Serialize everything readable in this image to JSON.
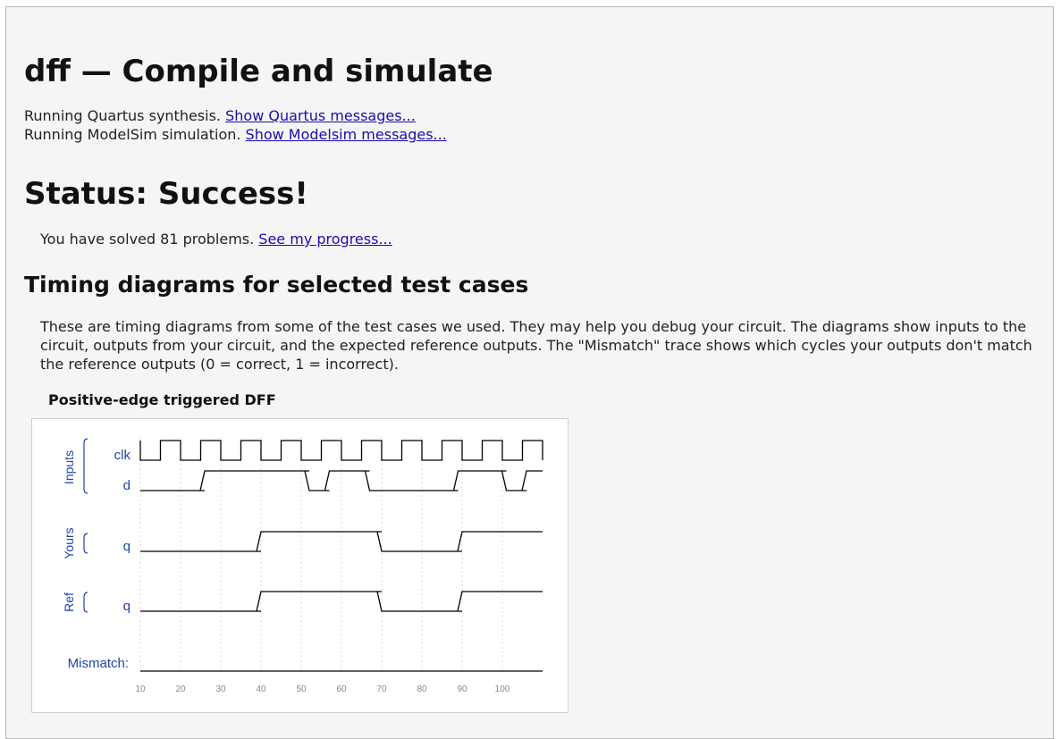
{
  "header": {
    "title": "dff — Compile and simulate"
  },
  "compile": {
    "quartus_text": "Running Quartus synthesis.",
    "quartus_link": "Show Quartus messages...",
    "modelsim_text": "Running ModelSim simulation.",
    "modelsim_link": "Show Modelsim messages..."
  },
  "status": {
    "heading": "Status: Success!",
    "solved_text": "You have solved 81 problems.",
    "progress_link": "See my progress..."
  },
  "timing": {
    "heading": "Timing diagrams for selected test cases",
    "description": "These are timing diagrams from some of the test cases we used. They may help you debug your circuit. The diagrams show inputs to the circuit, outputs from your circuit, and the expected reference outputs. The \"Mismatch\" trace shows which cycles your outputs don't match the reference outputs (0 = correct, 1 = incorrect).",
    "diagram_title": "Positive-edge triggered DFF"
  },
  "waveform": {
    "time_range": [
      5,
      110
    ],
    "ticks": [
      "10",
      "20",
      "30",
      "40",
      "50",
      "60",
      "70",
      "80",
      "90",
      "100"
    ],
    "groups": [
      {
        "label": "Inputs",
        "color": "#1f46a8"
      },
      {
        "label": "Yours",
        "color": "#1f46a8"
      },
      {
        "label": "Ref",
        "color": "#1f46a8"
      }
    ],
    "mismatch_label": "Mismatch:",
    "signals": [
      {
        "name": "clk",
        "group": "Inputs",
        "transitions": [
          [
            5,
            1
          ],
          [
            10,
            0
          ],
          [
            15,
            1
          ],
          [
            20,
            0
          ],
          [
            25,
            1
          ],
          [
            30,
            0
          ],
          [
            35,
            1
          ],
          [
            40,
            0
          ],
          [
            45,
            1
          ],
          [
            50,
            0
          ],
          [
            55,
            1
          ],
          [
            60,
            0
          ],
          [
            65,
            1
          ],
          [
            70,
            0
          ],
          [
            75,
            1
          ],
          [
            80,
            0
          ],
          [
            85,
            1
          ],
          [
            90,
            0
          ],
          [
            95,
            1
          ],
          [
            100,
            0
          ],
          [
            105,
            1
          ],
          [
            110,
            0
          ]
        ]
      },
      {
        "name": "d",
        "group": "Inputs",
        "transitions": [
          [
            5,
            0
          ],
          [
            26,
            1
          ],
          [
            52,
            0
          ],
          [
            57,
            1
          ],
          [
            67,
            0
          ],
          [
            89,
            1
          ],
          [
            101,
            0
          ],
          [
            106,
            1
          ]
        ]
      },
      {
        "name": "q",
        "group": "Yours",
        "transitions": [
          [
            5,
            0
          ],
          [
            40,
            1
          ],
          [
            70,
            0
          ],
          [
            90,
            1
          ]
        ]
      },
      {
        "name": "q",
        "group": "Ref",
        "transitions": [
          [
            5,
            0
          ],
          [
            40,
            1
          ],
          [
            70,
            0
          ],
          [
            90,
            1
          ]
        ]
      },
      {
        "name": "Mismatch:",
        "group": "Mismatch",
        "transitions": [
          [
            5,
            0
          ]
        ]
      }
    ],
    "line_color": "#000000"
  }
}
